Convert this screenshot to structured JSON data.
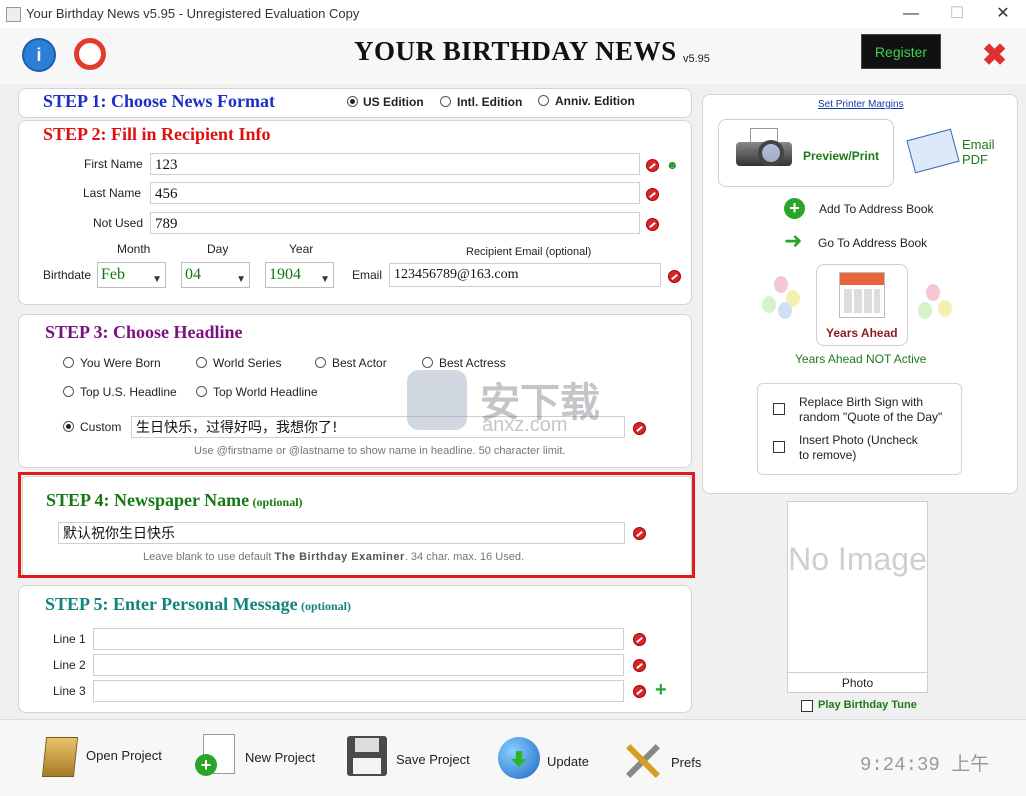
{
  "window": {
    "title": "Your Birthday News v5.95 - Unregistered Evaluation Copy"
  },
  "header": {
    "brand": "YOUR BIRTHDAY NEWS",
    "version": "v5.95",
    "register_label": "Register"
  },
  "step1": {
    "title": "STEP 1: Choose News Format",
    "options": [
      "US Edition",
      "Intl. Edition",
      "Anniv. Edition"
    ],
    "selected": "US Edition"
  },
  "step2": {
    "title": "STEP 2: Fill in Recipient Info",
    "first_name_label": "First Name",
    "first_name": "123",
    "last_name_label": "Last Name",
    "last_name": "456",
    "not_used_label": "Not Used",
    "not_used": "789",
    "birthdate_label": "Birthdate",
    "month_label": "Month",
    "month": "Feb",
    "day_label": "Day",
    "day": "04",
    "year_label": "Year",
    "year": "1904",
    "email_header": "Recipient Email (optional)",
    "email_label": "Email",
    "email": "123456789@163.com"
  },
  "step3": {
    "title": "STEP 3: Choose Headline",
    "options": [
      "You Were Born",
      "World Series",
      "Best Actor",
      "Best Actress",
      "Top U.S. Headline",
      "Top World Headline",
      "Custom"
    ],
    "selected": "Custom",
    "custom_value": "生日快乐，过得好吗，我想你了!",
    "hint": "Use @firstname or @lastname to show name in headline. 50 character limit."
  },
  "step4": {
    "title": "STEP 4: Newspaper Name",
    "optional": "(optional)",
    "value": "默认祝你生日快乐",
    "hint_pre": "Leave blank to use default ",
    "hint_bold": "The Birthday Examiner",
    "hint_post": ". 34 char. max. 16 Used."
  },
  "step5": {
    "title": "STEP 5: Enter Personal Message",
    "optional": "(optional)",
    "line1_label": "Line 1",
    "line2_label": "Line 2",
    "line3_label": "Line 3",
    "line1": "",
    "line2": "",
    "line3": ""
  },
  "right": {
    "printer_margins": "Set Printer Margins",
    "preview_print": "Preview/Print",
    "email_pdf": "Email\nPDF",
    "add_address": "Add To Address Book",
    "goto_address": "Go To Address Book",
    "years_ahead": "Years Ahead",
    "years_ahead_status": "Years Ahead NOT Active",
    "replace_sign": "Replace Birth Sign with random \"Quote of the Day\"",
    "insert_photo": "Insert Photo (Uncheck to remove)",
    "no_image": "No Image",
    "photo_label": "Photo",
    "play_tune": "Play Birthday Tune"
  },
  "bottom": {
    "open_project": "Open Project",
    "new_project": "New Project",
    "save_project": "Save Project",
    "update": "Update",
    "prefs": "Prefs",
    "clock": "9:24:39 上午"
  },
  "watermark": {
    "cn": "安下载",
    "url": "anxz.com"
  },
  "colors": {
    "step1": "#1a2fc8",
    "step2": "#e01010",
    "step3": "#7a1280",
    "step4": "#157a12",
    "step5": "#11837c"
  }
}
